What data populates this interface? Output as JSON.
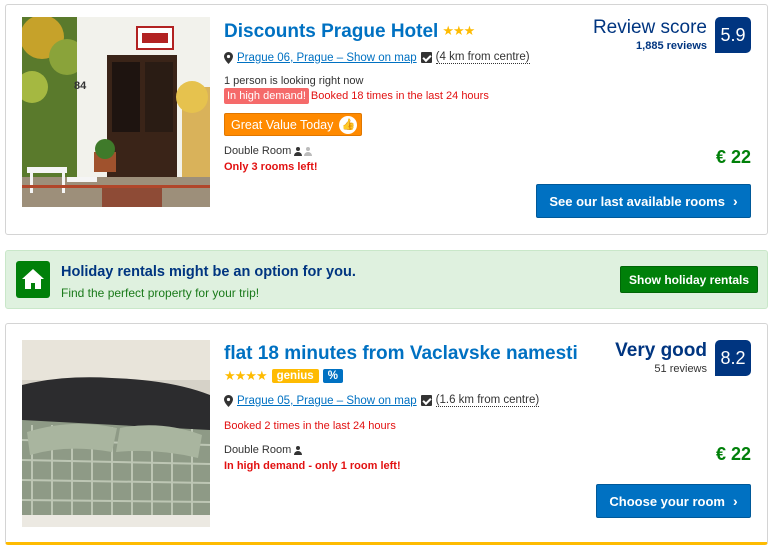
{
  "listings": [
    {
      "name": "Discounts Prague Hotel",
      "stars": "★★★",
      "location_link": "Prague 06, Prague – Show on map",
      "distance": "(4 km from centre)",
      "looking": "1 person is looking right now",
      "demand_badge": "In high demand!",
      "booked": "Booked 18 times in the last 24 hours",
      "value_badge": "Great Value Today",
      "room_type": "Double Room",
      "availability": "Only 3 rooms left!",
      "score_label": "Review score",
      "reviews": "1,885 reviews",
      "score": "5.9",
      "price": "€ 22",
      "cta": "See our last available rooms",
      "photo_text": {
        "house_number": "84"
      }
    },
    {
      "name": "flat 18 minutes from Vaclavske namesti",
      "stars": "★★★★",
      "genius": "genius",
      "deal": "%",
      "location_link": "Prague 05, Prague – Show on map",
      "distance": "(1.6 km from centre)",
      "booked": "Booked 2 times in the last 24 hours",
      "room_type": "Double Room",
      "availability": "In high demand - only 1 room left!",
      "score_label": "Very good",
      "reviews": "51 reviews",
      "score": "8.2",
      "price": "€ 22",
      "cta": "Choose your room"
    }
  ],
  "banner": {
    "title": "Holiday rentals might be an option for you.",
    "subtitle": "Find the perfect property for your trip!",
    "button": "Show holiday rentals"
  },
  "icons": {
    "chevron": "›",
    "thumbs_up": "👍"
  },
  "colors": {
    "brand_blue": "#0071c2",
    "dark_blue": "#003580",
    "price_green": "#008009",
    "urgency_red": "#e21111",
    "star_yellow": "#febb02",
    "value_orange": "#ff8a00"
  }
}
